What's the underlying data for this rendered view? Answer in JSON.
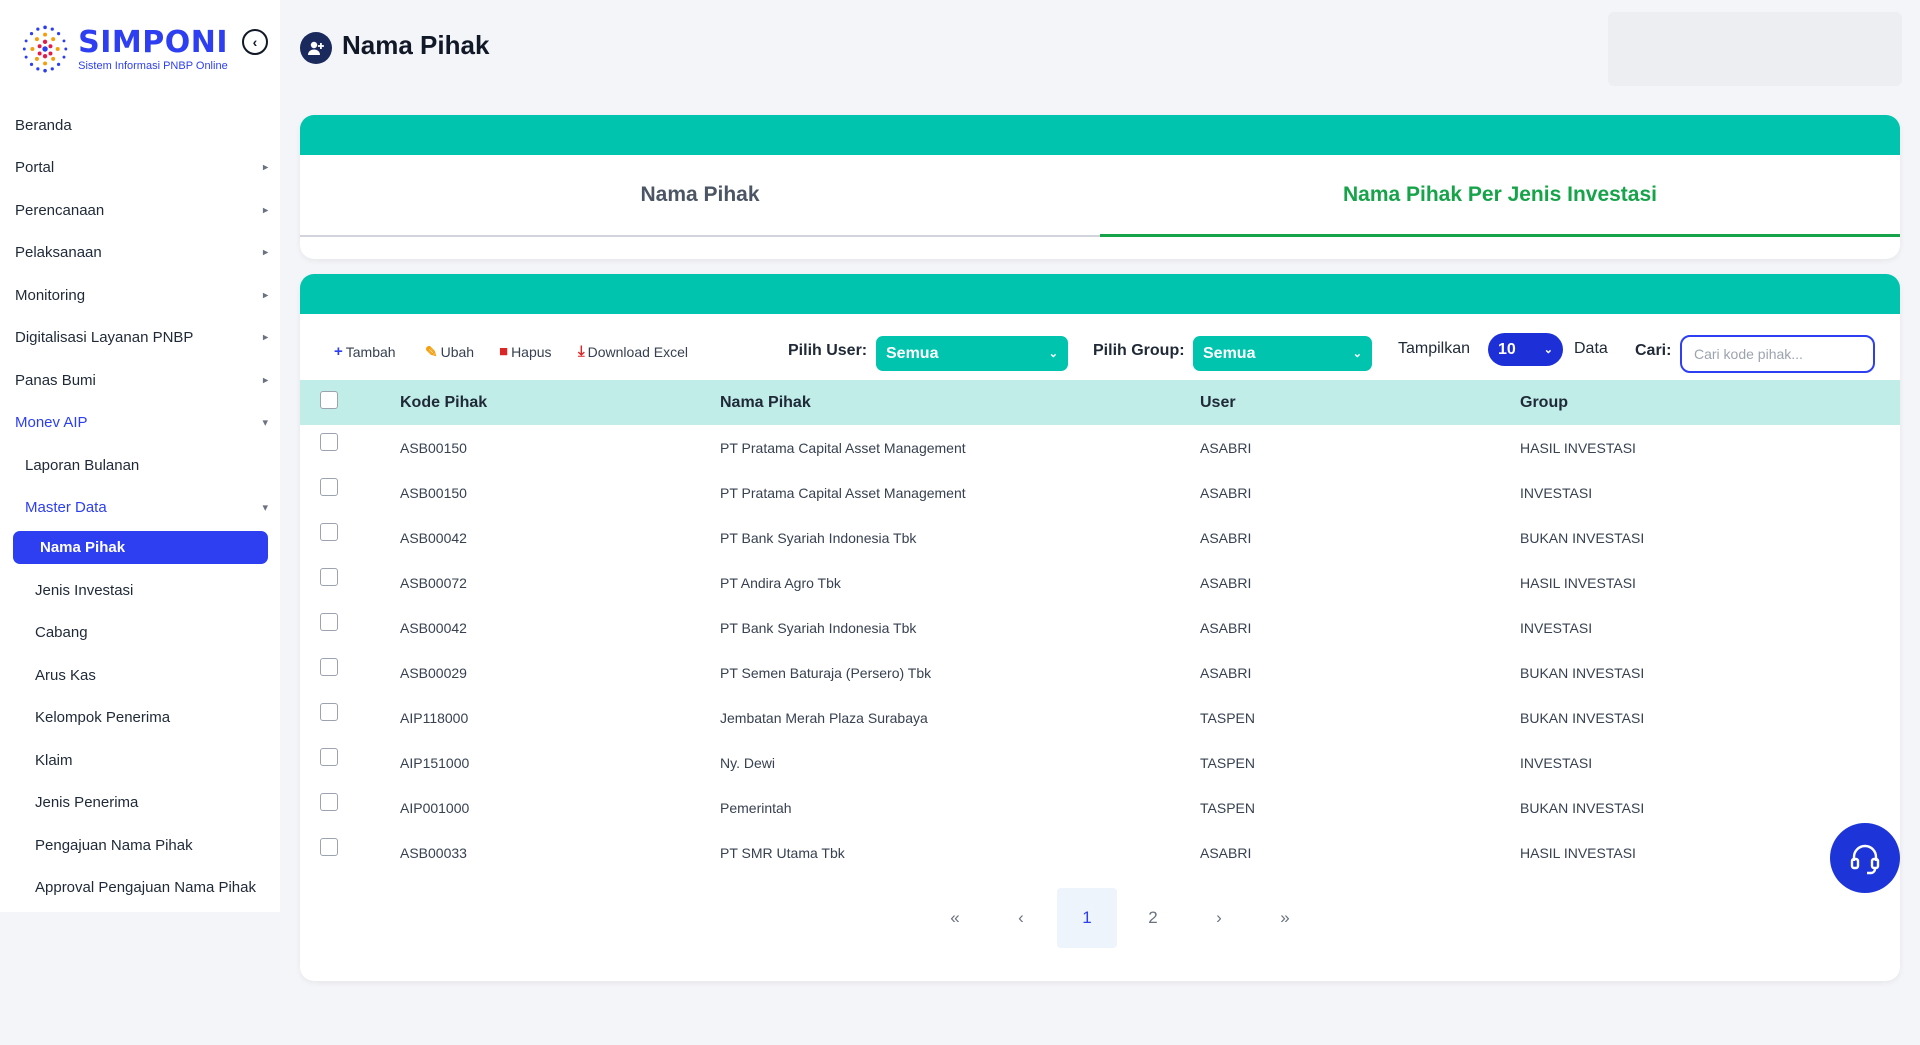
{
  "brand": {
    "name": "SIMPONI",
    "subtitle": "Sistem Informasi PNBP Online"
  },
  "sidebar": {
    "collapse_icon": "chevron-left-circle-icon",
    "items": [
      {
        "label": "Beranda"
      },
      {
        "label": "Portal"
      },
      {
        "label": "Perencanaan"
      },
      {
        "label": "Pelaksanaan"
      },
      {
        "label": "Monitoring"
      },
      {
        "label": "Digitalisasi Layanan PNBP"
      },
      {
        "label": "Panas Bumi"
      },
      {
        "label": "Monev AIP"
      },
      {
        "label": "Laporan Bulanan"
      },
      {
        "label": "Master Data"
      },
      {
        "label": "Nama Pihak"
      },
      {
        "label": "Jenis Investasi"
      },
      {
        "label": "Cabang"
      },
      {
        "label": "Arus Kas"
      },
      {
        "label": "Kelompok Penerima"
      },
      {
        "label": "Klaim"
      },
      {
        "label": "Jenis Penerima"
      },
      {
        "label": "Pengajuan Nama Pihak"
      },
      {
        "label": "Approval Pengajuan Nama Pihak"
      }
    ]
  },
  "header": {
    "title": "Nama Pihak",
    "icon": "user-add-icon"
  },
  "tabs": [
    {
      "label": "Nama Pihak",
      "active": false
    },
    {
      "label": "Nama Pihak Per Jenis Investasi",
      "active": true
    }
  ],
  "toolbar": {
    "add_label": "Tambah",
    "edit_label": "Ubah",
    "delete_label": "Hapus",
    "download_label": "Download Excel",
    "user_filter_label": "Pilih User:",
    "user_filter_value": "Semua",
    "group_filter_label": "Pilih Group:",
    "group_filter_value": "Semua",
    "show_label": "Tampilkan",
    "show_value": "10",
    "show_suffix": "Data",
    "search_label": "Cari:",
    "search_placeholder": "Cari kode pihak..."
  },
  "table": {
    "columns": [
      "Kode Pihak",
      "Nama Pihak",
      "User",
      "Group"
    ],
    "rows": [
      [
        "ASB00150",
        "PT Pratama Capital Asset Management",
        "ASABRI",
        "HASIL INVESTASI"
      ],
      [
        "ASB00150",
        "PT Pratama Capital Asset Management",
        "ASABRI",
        "INVESTASI"
      ],
      [
        "ASB00042",
        "PT Bank Syariah Indonesia Tbk",
        "ASABRI",
        "BUKAN INVESTASI"
      ],
      [
        "ASB00072",
        "PT Andira Agro Tbk",
        "ASABRI",
        "HASIL INVESTASI"
      ],
      [
        "ASB00042",
        "PT Bank Syariah Indonesia Tbk",
        "ASABRI",
        "INVESTASI"
      ],
      [
        "ASB00029",
        "PT Semen Baturaja (Persero) Tbk",
        "ASABRI",
        "BUKAN INVESTASI"
      ],
      [
        "AIP118000",
        "Jembatan Merah Plaza Surabaya",
        "TASPEN",
        "BUKAN INVESTASI"
      ],
      [
        "AIP151000",
        "Ny. Dewi",
        "TASPEN",
        "INVESTASI"
      ],
      [
        "AIP001000",
        "Pemerintah",
        "TASPEN",
        "BUKAN INVESTASI"
      ],
      [
        "ASB00033",
        "PT SMR Utama Tbk",
        "ASABRI",
        "HASIL INVESTASI"
      ]
    ]
  },
  "pagination": {
    "first": "«",
    "prev": "‹",
    "pages": [
      "1",
      "2"
    ],
    "current": "1",
    "next": "›",
    "last": "»"
  },
  "colors": {
    "accent_teal": "#00c4ae",
    "brand_blue": "#2d3ff0",
    "active_tab_green": "#16a34a"
  }
}
